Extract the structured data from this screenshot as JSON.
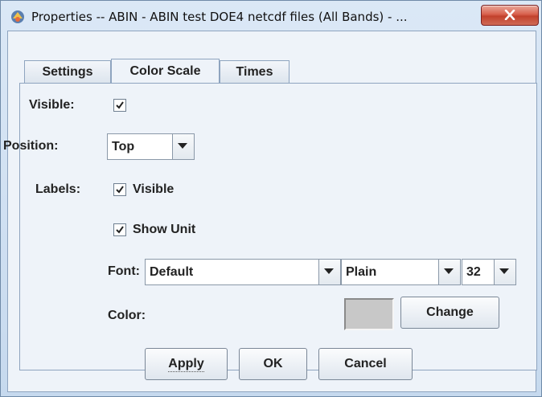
{
  "window": {
    "title": "Properties -- ABIN - ABIN test DOE4 netcdf files (All Bands) - ...",
    "icon": "app-icon",
    "close_icon": "close-icon"
  },
  "tabs": [
    {
      "label": "Settings",
      "active": false
    },
    {
      "label": "Color Scale",
      "active": true
    },
    {
      "label": "Times",
      "active": false
    }
  ],
  "form": {
    "visible_label": "Visible:",
    "visible_checked": true,
    "position_label": "Position:",
    "position_value": "Top",
    "labels_label": "Labels:",
    "labels_visible_label": "Visible",
    "labels_visible_checked": true,
    "show_unit_label": "Show Unit",
    "show_unit_checked": true,
    "font_label": "Font:",
    "font_value": "Default",
    "style_value": "Plain",
    "size_value": "32",
    "color_label": "Color:",
    "color_swatch": "#c8c8c8",
    "change_label": "Change"
  },
  "buttons": {
    "apply": "Apply",
    "ok": "OK",
    "cancel": "Cancel"
  }
}
